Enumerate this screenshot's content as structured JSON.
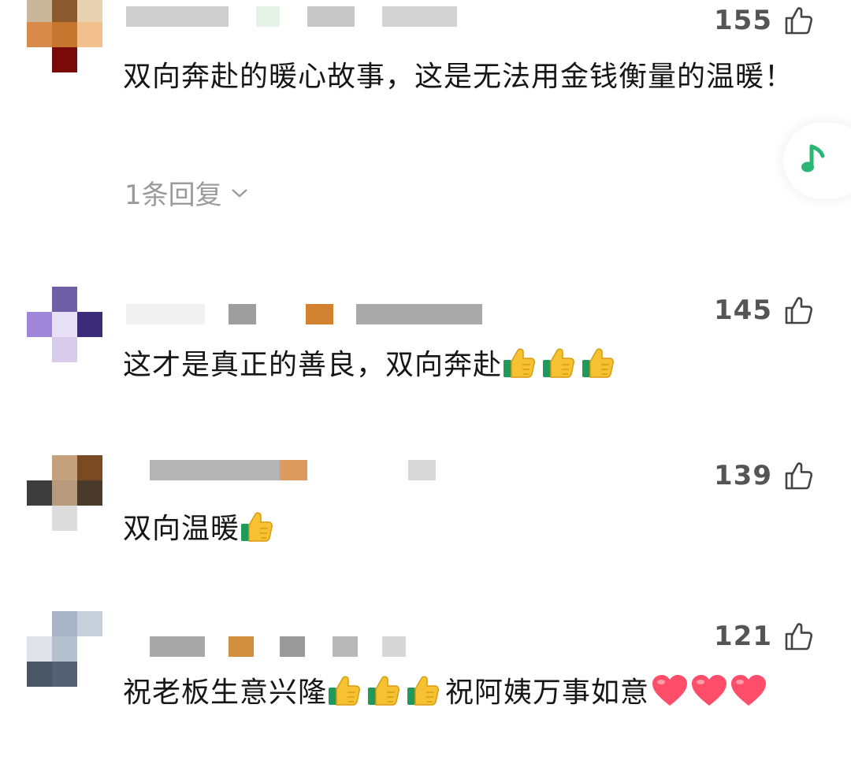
{
  "comments": [
    {
      "likes": "155",
      "text": "双向奔赴的暖心故事，这是无法用金钱衡量的温暖！",
      "replies_label": "1条回复",
      "avatar_colors": [
        "#c9b79a",
        "#8a5a2e",
        "#e8d3b0",
        "#d88a4a",
        "#c7772d",
        "#f2c08c",
        "#ffffff",
        "#7a0a0a",
        "#ffffff"
      ]
    },
    {
      "likes": "145",
      "text": "这才是真正的善良，双向奔赴",
      "emoji_count": 3,
      "avatar_colors": [
        "#ffffff",
        "#6f5fa8",
        "#ffffff",
        "#9f86d8",
        "#e8e0f4",
        "#3b2b78",
        "#ffffff",
        "#d7cdea",
        "#ffffff"
      ]
    },
    {
      "likes": "139",
      "text": "双向温暖",
      "emoji_count": 1,
      "avatar_colors": [
        "#ffffff",
        "#c4a07c",
        "#7a4a22",
        "#3d3d3d",
        "#b79a7c",
        "#4a3a2a",
        "#ffffff",
        "#dcdcdc",
        "#ffffff"
      ]
    },
    {
      "likes": "121",
      "text_before": "祝老板生意兴隆",
      "text_after": "祝阿姨万事如意",
      "emoji_count": 3,
      "heart_count": 3,
      "avatar_colors": [
        "#ffffff",
        "#a7b3c7",
        "#c8d0dc",
        "#e0e4ea",
        "#b5c0cf",
        "#ffffff",
        "#4a5664",
        "#536173",
        "#ffffff"
      ]
    }
  ],
  "icons": {
    "like": "thumbs-up-outline-icon",
    "emoji": "thumbs-up-emoji",
    "heart": "red-heart-emoji",
    "chevron": "chevron-down-icon",
    "music": "music-note-icon"
  },
  "colors": {
    "like_count": "#555555",
    "replies": "#9a9a9a",
    "music_note": "#2bb673",
    "heart": "#ff4d6a"
  }
}
